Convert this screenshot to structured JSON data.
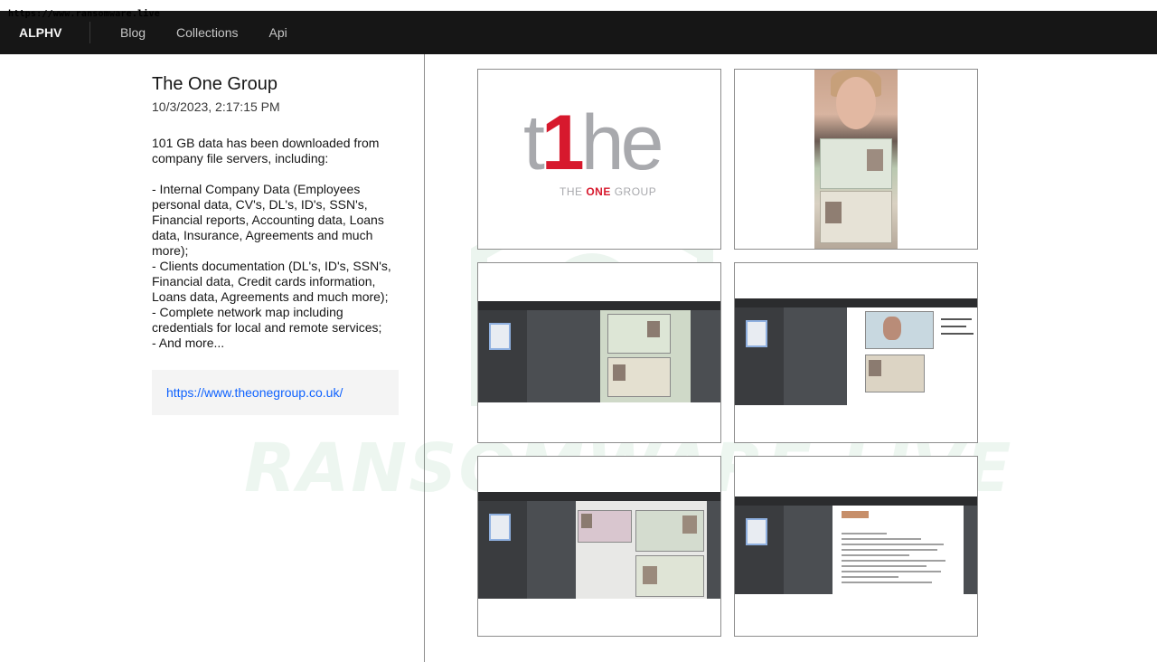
{
  "watermark_url": "https://www.ransomware.live",
  "topbar": {
    "brand": "ALPHV",
    "nav": [
      "Blog",
      "Collections",
      "Api"
    ]
  },
  "post": {
    "title": "The One Group",
    "timestamp": "10/3/2023, 2:17:15 PM",
    "description": "101 GB data has been downloaded from company file servers, including:\n\n- Internal Company Data (Employees personal data, CV's, DL's, ID's, SSN's, Financial reports, Accounting data, Loans data, Insurance, Agreements and much more);\n- Clients documentation (DL's, ID's, SSN's, Financial data, Credit cards information, Loans data, Agreements and much more);\n- Complete network map including credentials for local and remote services;\n- And more...",
    "link": "https://www.theonegroup.co.uk/"
  },
  "gallery": {
    "watermark_text": "RANSOMWARE.LIVE",
    "logo": {
      "mark_t": "t",
      "mark_one": "1",
      "mark_e": "he",
      "caption_prefix": "THE ",
      "caption_highlight": "ONE",
      "caption_suffix": " GROUP"
    },
    "images": [
      "company-logo",
      "selfie-with-passport",
      "passport-scan-viewer",
      "id-documents-viewer",
      "passport-and-license-viewer",
      "university-letter-viewer"
    ]
  }
}
